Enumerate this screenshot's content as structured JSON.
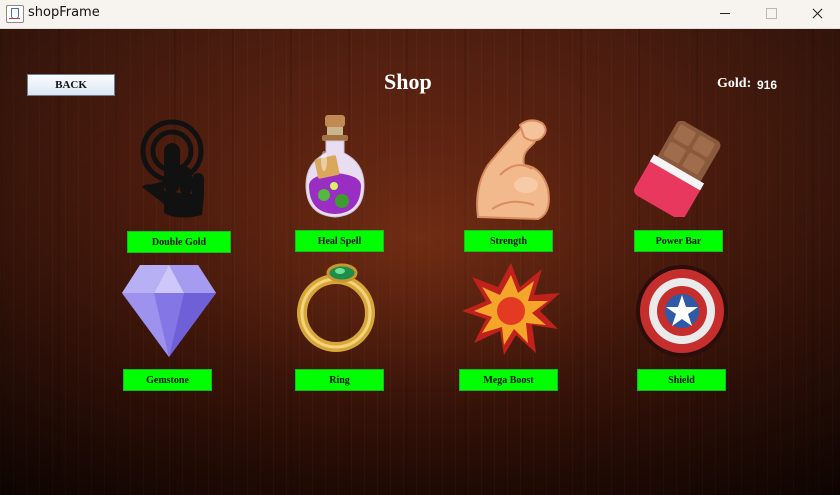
{
  "window": {
    "title": "shopFrame"
  },
  "header": {
    "back_label": "BACK",
    "title": "Shop",
    "gold_label": "Gold:",
    "gold_value": "916"
  },
  "items": [
    {
      "label": "Double Gold",
      "icon": "hand-tap-icon"
    },
    {
      "label": "Heal Spell",
      "icon": "potion-icon"
    },
    {
      "label": "Strength",
      "icon": "flexed-arm-icon"
    },
    {
      "label": "Power Bar",
      "icon": "chocolate-bar-icon"
    },
    {
      "label": "Gemstone",
      "icon": "diamond-icon"
    },
    {
      "label": "Ring",
      "icon": "ring-icon"
    },
    {
      "label": "Mega Boost",
      "icon": "explosion-icon"
    },
    {
      "label": "Shield",
      "icon": "shield-icon"
    }
  ],
  "colors": {
    "button_green": "#00ff00",
    "text_white": "#ffffff"
  }
}
